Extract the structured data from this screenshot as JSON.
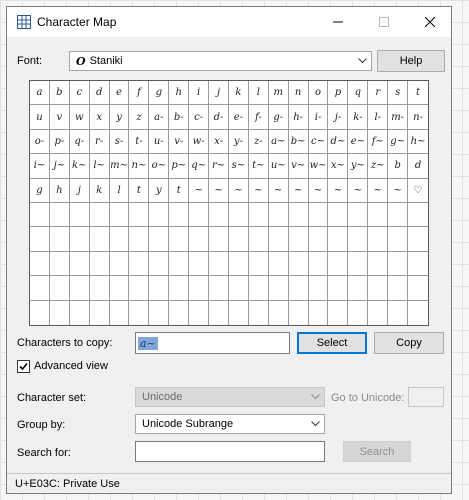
{
  "window": {
    "title": "Character Map"
  },
  "font": {
    "label": "Font:",
    "selected": "Staniki",
    "font_icon": "O",
    "help_label": "Help"
  },
  "grid": {
    "cells": [
      "a",
      "b",
      "c",
      "d",
      "e",
      "f",
      "g",
      "h",
      "i",
      "j",
      "k",
      "l",
      "m",
      "n",
      "o",
      "p",
      "q",
      "r",
      "s",
      "t",
      "u",
      "v",
      "w",
      "x",
      "y",
      "z",
      "a-",
      "b-",
      "c-",
      "d-",
      "e-",
      "f-",
      "g-",
      "h-",
      "i-",
      "j-",
      "k-",
      "l-",
      "m-",
      "n-",
      "o-",
      "p-",
      "q-",
      "r-",
      "s-",
      "t-",
      "u-",
      "v-",
      "w-",
      "x-",
      "y-",
      "z-",
      "a~",
      "b~",
      "c~",
      "d~",
      "e~",
      "f~",
      "g~",
      "h~",
      "i~",
      "j~",
      "k~",
      "l~",
      "m~",
      "n~",
      "o~",
      "p~",
      "q~",
      "r~",
      "s~",
      "t~",
      "u~",
      "v~",
      "w~",
      "x~",
      "y~",
      "z~",
      "b",
      "d",
      "g",
      "h",
      "j",
      "k",
      "l",
      "t",
      "y",
      "t",
      "~",
      "~",
      "~",
      "~",
      "~",
      "~",
      "~",
      "~",
      "~",
      "~",
      "~",
      "♡"
    ]
  },
  "copy": {
    "label": "Characters to copy:",
    "value": "a~",
    "select_label": "Select",
    "copy_label": "Copy"
  },
  "advanced": {
    "label": "Advanced view",
    "checked": true
  },
  "charset": {
    "label": "Character set:",
    "value": "Unicode",
    "goto_label": "Go to Unicode:"
  },
  "groupby": {
    "label": "Group by:",
    "value": "Unicode Subrange"
  },
  "search": {
    "label": "Search for:",
    "button_label": "Search"
  },
  "status": {
    "text": "U+E03C: Private Use"
  }
}
